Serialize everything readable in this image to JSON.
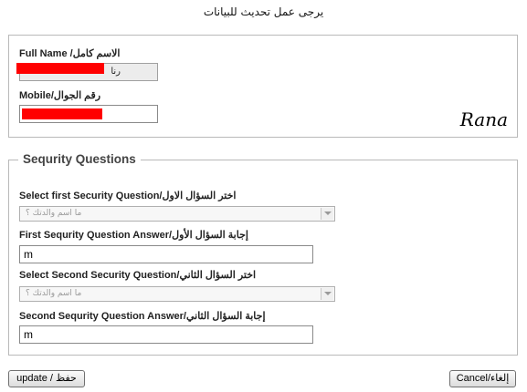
{
  "page_title": "يرجى عمل تحديث للبيانات",
  "account": {
    "full_name_label": "Full Name /الاسم كامل",
    "full_name_value": "رنا",
    "mobile_label": "Mobile/رقم الجوال",
    "signature": "Rana"
  },
  "security": {
    "legend": "Sequrity Questions",
    "q1_label": "Select first Security Question/اختر السؤال الاول",
    "q1_selected": "ما اسم والدتك ؟",
    "a1_label": "First Sequrity Question Answer/إجابة السؤال الأول",
    "a1_value": "m",
    "q2_label": "Select Second Security Question/اختر السؤال الثاني",
    "q2_selected": "ما اسم والدتك ؟",
    "a2_label": "Second Sequrity Question Answer/إجابة السؤال الثاني",
    "a2_value": "m"
  },
  "buttons": {
    "update": "update / حفظ",
    "cancel": "Cancel/إلغاء"
  },
  "colors": {
    "redaction": "#ff0000",
    "border": "#b9b9b9"
  }
}
